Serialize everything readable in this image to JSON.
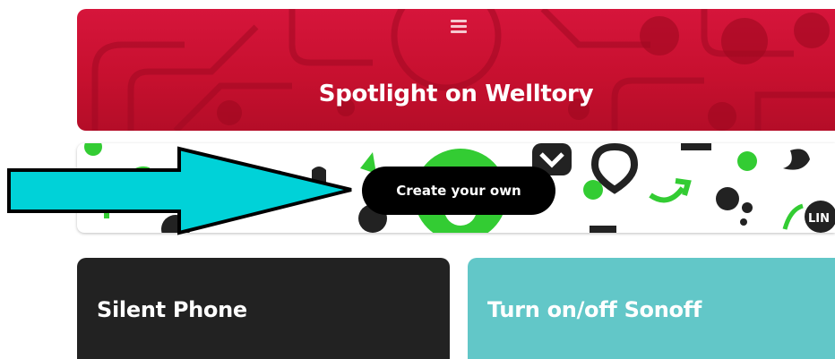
{
  "spotlight": {
    "title": "Spotlight on Welltory",
    "menu_icon": "menu-icon",
    "color": "#c7102f"
  },
  "create": {
    "button_label": "Create your own",
    "background_icons": [
      "apple-icon",
      "leaf-icon",
      "pocket-icon",
      "location-icon",
      "trend-arrow-icon",
      "twitter-icon",
      "linkedin-icon",
      "dots-icon",
      "evernote-icon",
      "check-circle-icon"
    ],
    "label_text": "LIN",
    "accent_color": "#33cc33"
  },
  "annotation": {
    "arrow_color": "#00d2d8",
    "arrow_icon": "arrow-right-icon"
  },
  "applets": [
    {
      "title": "Silent Phone",
      "color": "#222222"
    },
    {
      "title": "Turn on/off Sonoff",
      "color": "#62c7c8"
    }
  ]
}
